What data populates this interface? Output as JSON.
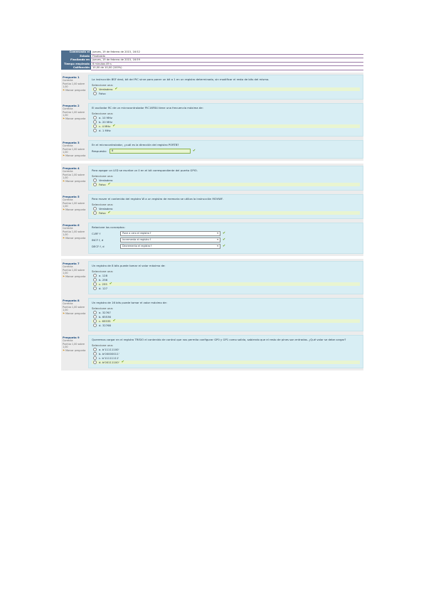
{
  "summary": [
    {
      "k": "Comenzado el",
      "v": "jueves, 19 de febrero de 2015, 16:52"
    },
    {
      "k": "Estado",
      "v": "Finalizado"
    },
    {
      "k": "Finalizado en",
      "v": "jueves, 19 de febrero de 2015, 16:59"
    },
    {
      "k": "Tiempo empleado",
      "v": "6 minutos 49 s"
    },
    {
      "k": "Calificación",
      "v": "10,00 de 10,00 (100%)"
    }
  ],
  "group1": [
    {
      "qno": "Pregunta 1",
      "state": "Correcta",
      "mark": "Puntúa 1,00 sobre 1,00",
      "flag": "Marcar pregunta",
      "prompt": "La instrucción BSF dest, bit del PIC sirve para poner un bit a 1 en un registro determinado, sin modificar el resto de bits del mismo.",
      "select": "Seleccione una:",
      "options": [
        {
          "t": "Verdadero",
          "c": true
        },
        {
          "t": "Falso",
          "c": false
        }
      ]
    },
    {
      "qno": "Pregunta 2",
      "state": "Correcta",
      "mark": "Puntúa 1,00 sobre 1,00",
      "flag": "Marcar pregunta",
      "prompt": "El oscilador RC de un microcontrolador PIC16F84 tiene una frecuencia máxima de:",
      "select": "Seleccione una:",
      "options": [
        {
          "t": "a. 10 MHz",
          "c": false
        },
        {
          "t": "b. 20 MHz",
          "c": false
        },
        {
          "t": "c. 4 MHz",
          "c": true
        },
        {
          "t": "d. 1 MHz",
          "c": false
        }
      ]
    },
    {
      "qno": "Pregunta 3",
      "state": "Correcta",
      "mark": "Puntúa 1,00 sobre 1,00",
      "flag": "Marcar pregunta",
      "prompt": "En el microcontrolador, ¿cuál es la dirección del registro PORTB?",
      "answerlabel": "Respuesta:",
      "answer": "6"
    }
  ],
  "group2": [
    {
      "qno": "Pregunta 4",
      "state": "Correcta",
      "mark": "Puntúa 1,00 sobre 1,00",
      "flag": "Marcar pregunta",
      "prompt": "Para apagar un LED se escribe un 0 en el bit correspondiente del puerto GPIO.",
      "select": "Seleccione una:",
      "options": [
        {
          "t": "Verdadero",
          "c": false
        },
        {
          "t": "Falso",
          "c": true
        }
      ]
    },
    {
      "qno": "Pregunta 5",
      "state": "Correcta",
      "mark": "Puntúa 1,00 sobre 1,00",
      "flag": "Marcar pregunta",
      "prompt": "Para mover el contenido del registro W a un registro de memoria se utiliza la instrucción MOVWF.",
      "select": "Seleccione una:",
      "options": [
        {
          "t": "Verdadero",
          "c": false
        },
        {
          "t": "Falso",
          "c": true
        }
      ]
    },
    {
      "qno": "Pregunta 6",
      "state": "Correcta",
      "mark": "Puntúa 1,00 sobre 1,00",
      "flag": "Marcar pregunta",
      "prompt": "Relacione los conceptos:",
      "rows": [
        {
          "l": "CLRF f",
          "v": "Pone a cero el registro f"
        },
        {
          "l": "INCF f, d",
          "v": "Incrementa el registro f"
        },
        {
          "l": "DECF f, d",
          "v": "Decrementa el registro f"
        }
      ]
    }
  ],
  "group3": [
    {
      "qno": "Pregunta 7",
      "state": "Correcta",
      "mark": "Puntúa 1,00 sobre 1,00",
      "flag": "Marcar pregunta",
      "prompt": "Un registro de 8 bits puede tomar el valor máximo de:",
      "select": "Seleccione una:",
      "options": [
        {
          "t": "a. 128",
          "c": false
        },
        {
          "t": "b. 256",
          "c": false
        },
        {
          "t": "c. 255",
          "c": true
        },
        {
          "t": "d. 127",
          "c": false
        }
      ]
    },
    {
      "qno": "Pregunta 8",
      "state": "Correcta",
      "mark": "Puntúa 1,00 sobre 1,00",
      "flag": "Marcar pregunta",
      "prompt": "Un registro de 16 bits puede tomar el valor máximo de:",
      "select": "Seleccione una:",
      "options": [
        {
          "t": "a. 32767",
          "c": false
        },
        {
          "t": "b. 65536",
          "c": false
        },
        {
          "t": "c. 65535",
          "c": true
        },
        {
          "t": "d. 32768",
          "c": false
        }
      ]
    },
    {
      "qno": "Pregunta 9",
      "state": "Correcta",
      "mark": "Puntúa 1,00 sobre 1,00",
      "flag": "Marcar pregunta",
      "prompt": "Queremos cargar en el registro TRISIO el contenido de control que nos permita configurar GP0 y GP1 como salida, sabiendo que el resto de pines son entradas. ¿Qué valor se debe cargar?",
      "select": "Seleccione una:",
      "options": [
        {
          "t": "a. b'11111100'",
          "c": false
        },
        {
          "t": "b. b'00000011'",
          "c": false
        },
        {
          "t": "c. b'11111111'",
          "c": false
        },
        {
          "t": "d. b'00111100'",
          "c": true
        }
      ]
    }
  ]
}
